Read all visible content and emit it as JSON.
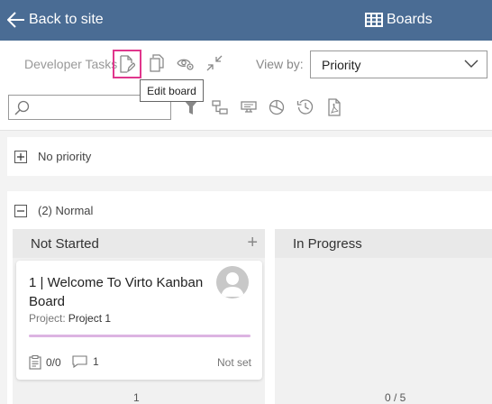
{
  "topbar": {
    "back_label": "Back to site",
    "boards_label": "Boards"
  },
  "toolbar": {
    "board_name": "Developer Tasks",
    "tooltip": "Edit board",
    "view_by_label": "View by:",
    "view_by_value": "Priority",
    "search_value": ""
  },
  "groups": [
    {
      "label": "No priority",
      "expanded": false
    },
    {
      "label": "(2) Normal",
      "expanded": true
    }
  ],
  "columns": [
    {
      "title": "Not Started",
      "count": "1"
    },
    {
      "title": "In Progress",
      "count": "0 / 5"
    }
  ],
  "card": {
    "title": "1 | Welcome To Virto Kanban Board",
    "project_label": "Project:",
    "project_value": "Project 1",
    "checklist": "0/0",
    "comments": "1",
    "status": "Not set",
    "bar_color": "#dcb4e2"
  },
  "colors": {
    "header": "#4a6c94",
    "highlight": "#e0368c"
  }
}
